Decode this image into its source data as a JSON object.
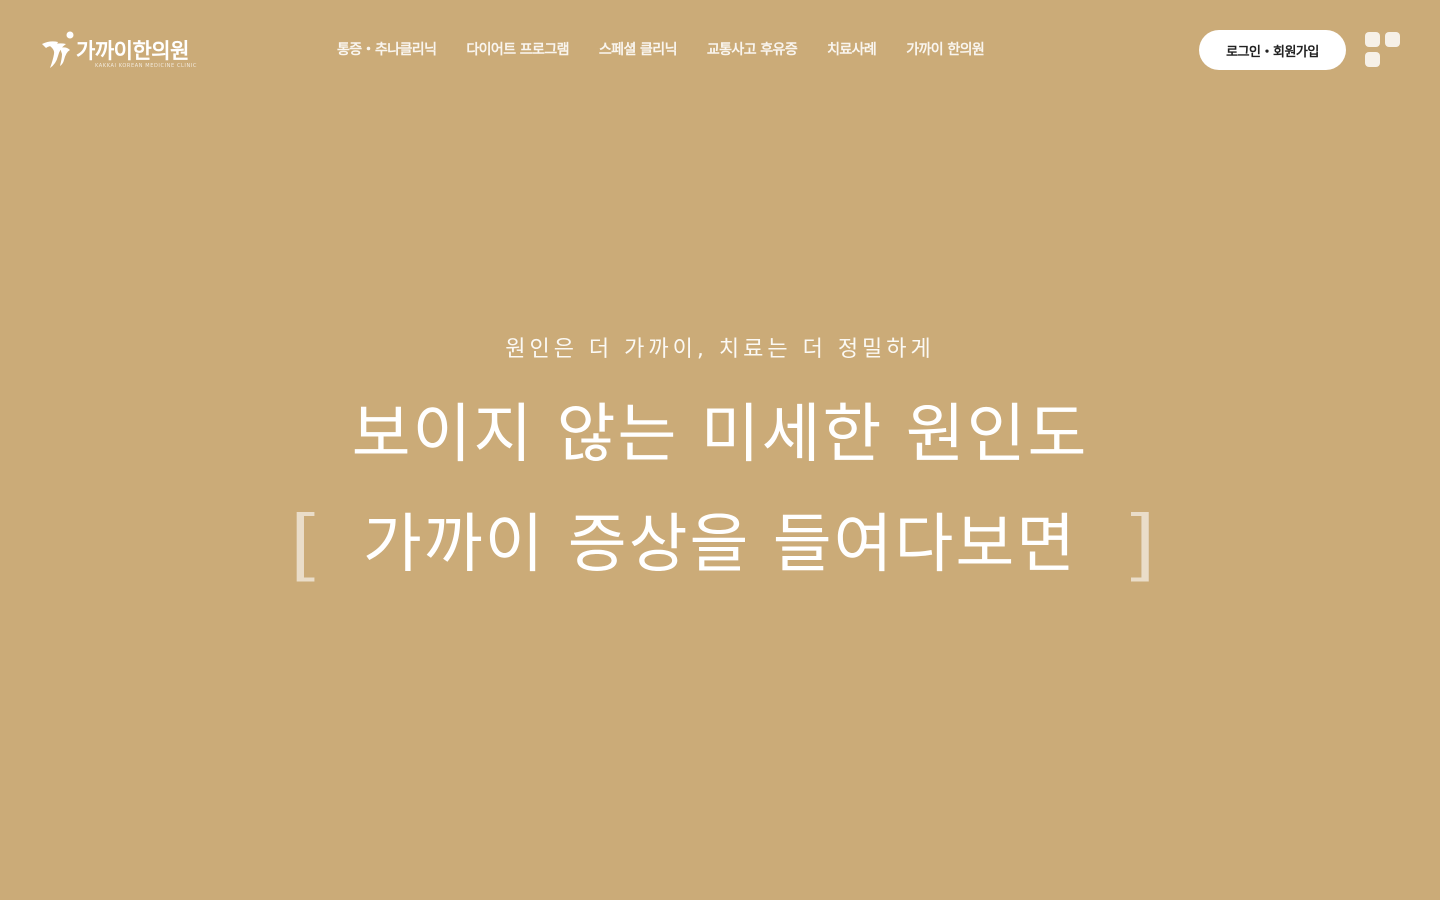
{
  "brand": {
    "name": "가까이한의원",
    "tagline": "KAKKAI KOREAN MEDICINE CLINIC"
  },
  "nav": {
    "items": [
      {
        "label": "통증・추나클리닉"
      },
      {
        "label": "다이어트 프로그램"
      },
      {
        "label": "스페셜 클리닉"
      },
      {
        "label": "교통사고 후유증"
      },
      {
        "label": "치료사례"
      },
      {
        "label": "가까이 한의원"
      }
    ],
    "login_label": "로그인・회원가입",
    "menu_icon": "grid-menu-icon"
  },
  "hero": {
    "subtitle": "원인은 더 가까이, 치료는 더 정밀하게",
    "title_line1": "보이지 않는 미세한 원인도",
    "title_line2": "가까이 증상을 들여다보면",
    "bracket_left": "[",
    "bracket_right": "]"
  },
  "colors": {
    "background": "#cbab78",
    "text": "#ffffff",
    "button_bg": "#ffffff",
    "button_text": "#222222"
  }
}
